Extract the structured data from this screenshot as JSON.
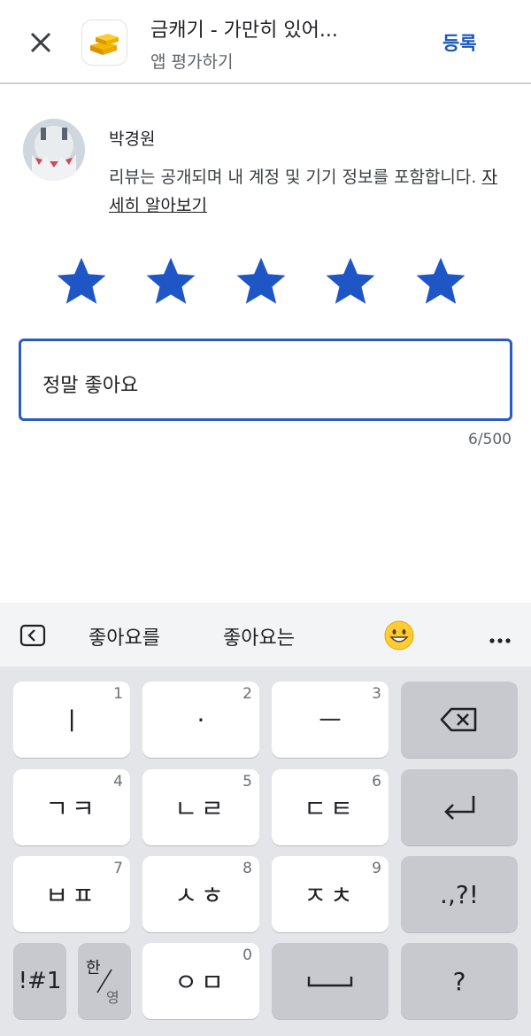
{
  "header": {
    "app_title": "금캐기 - 가만히 있어...",
    "subtitle": "앱 평가하기",
    "submit_label": "등록"
  },
  "user": {
    "name": "박경원",
    "notice_text": "리뷰는 공개되며 내 계정 및 기기 정보를 포함합니다. ",
    "learn_more": "자세히 알아보기"
  },
  "rating": {
    "value": 5,
    "max": 5,
    "star_color": "#1f56c5"
  },
  "review": {
    "text": "정말 좋아요",
    "counter": "6/500"
  },
  "suggestions": {
    "items": [
      "좋아요를",
      "좋아요는"
    ],
    "emoji": "grinning-face-emoji"
  },
  "keyboard": {
    "row1": [
      {
        "label": "ㅣ",
        "num": "1"
      },
      {
        "label": "·",
        "num": "2"
      },
      {
        "label": "ㅡ",
        "num": "3"
      }
    ],
    "row2": [
      {
        "label": "ㄱㅋ",
        "num": "4"
      },
      {
        "label": "ㄴㄹ",
        "num": "5"
      },
      {
        "label": "ㄷㅌ",
        "num": "6"
      }
    ],
    "row3": [
      {
        "label": "ㅂㅍ",
        "num": "7"
      },
      {
        "label": "ㅅㅎ",
        "num": "8"
      },
      {
        "label": "ㅈㅊ",
        "num": "9"
      }
    ],
    "punct_label": ".,?!",
    "symbols_label": "!#1",
    "lang_top": "한",
    "lang_bottom": "영",
    "zero_label": "ㅇㅁ",
    "zero_num": "0",
    "question_label": "?"
  }
}
